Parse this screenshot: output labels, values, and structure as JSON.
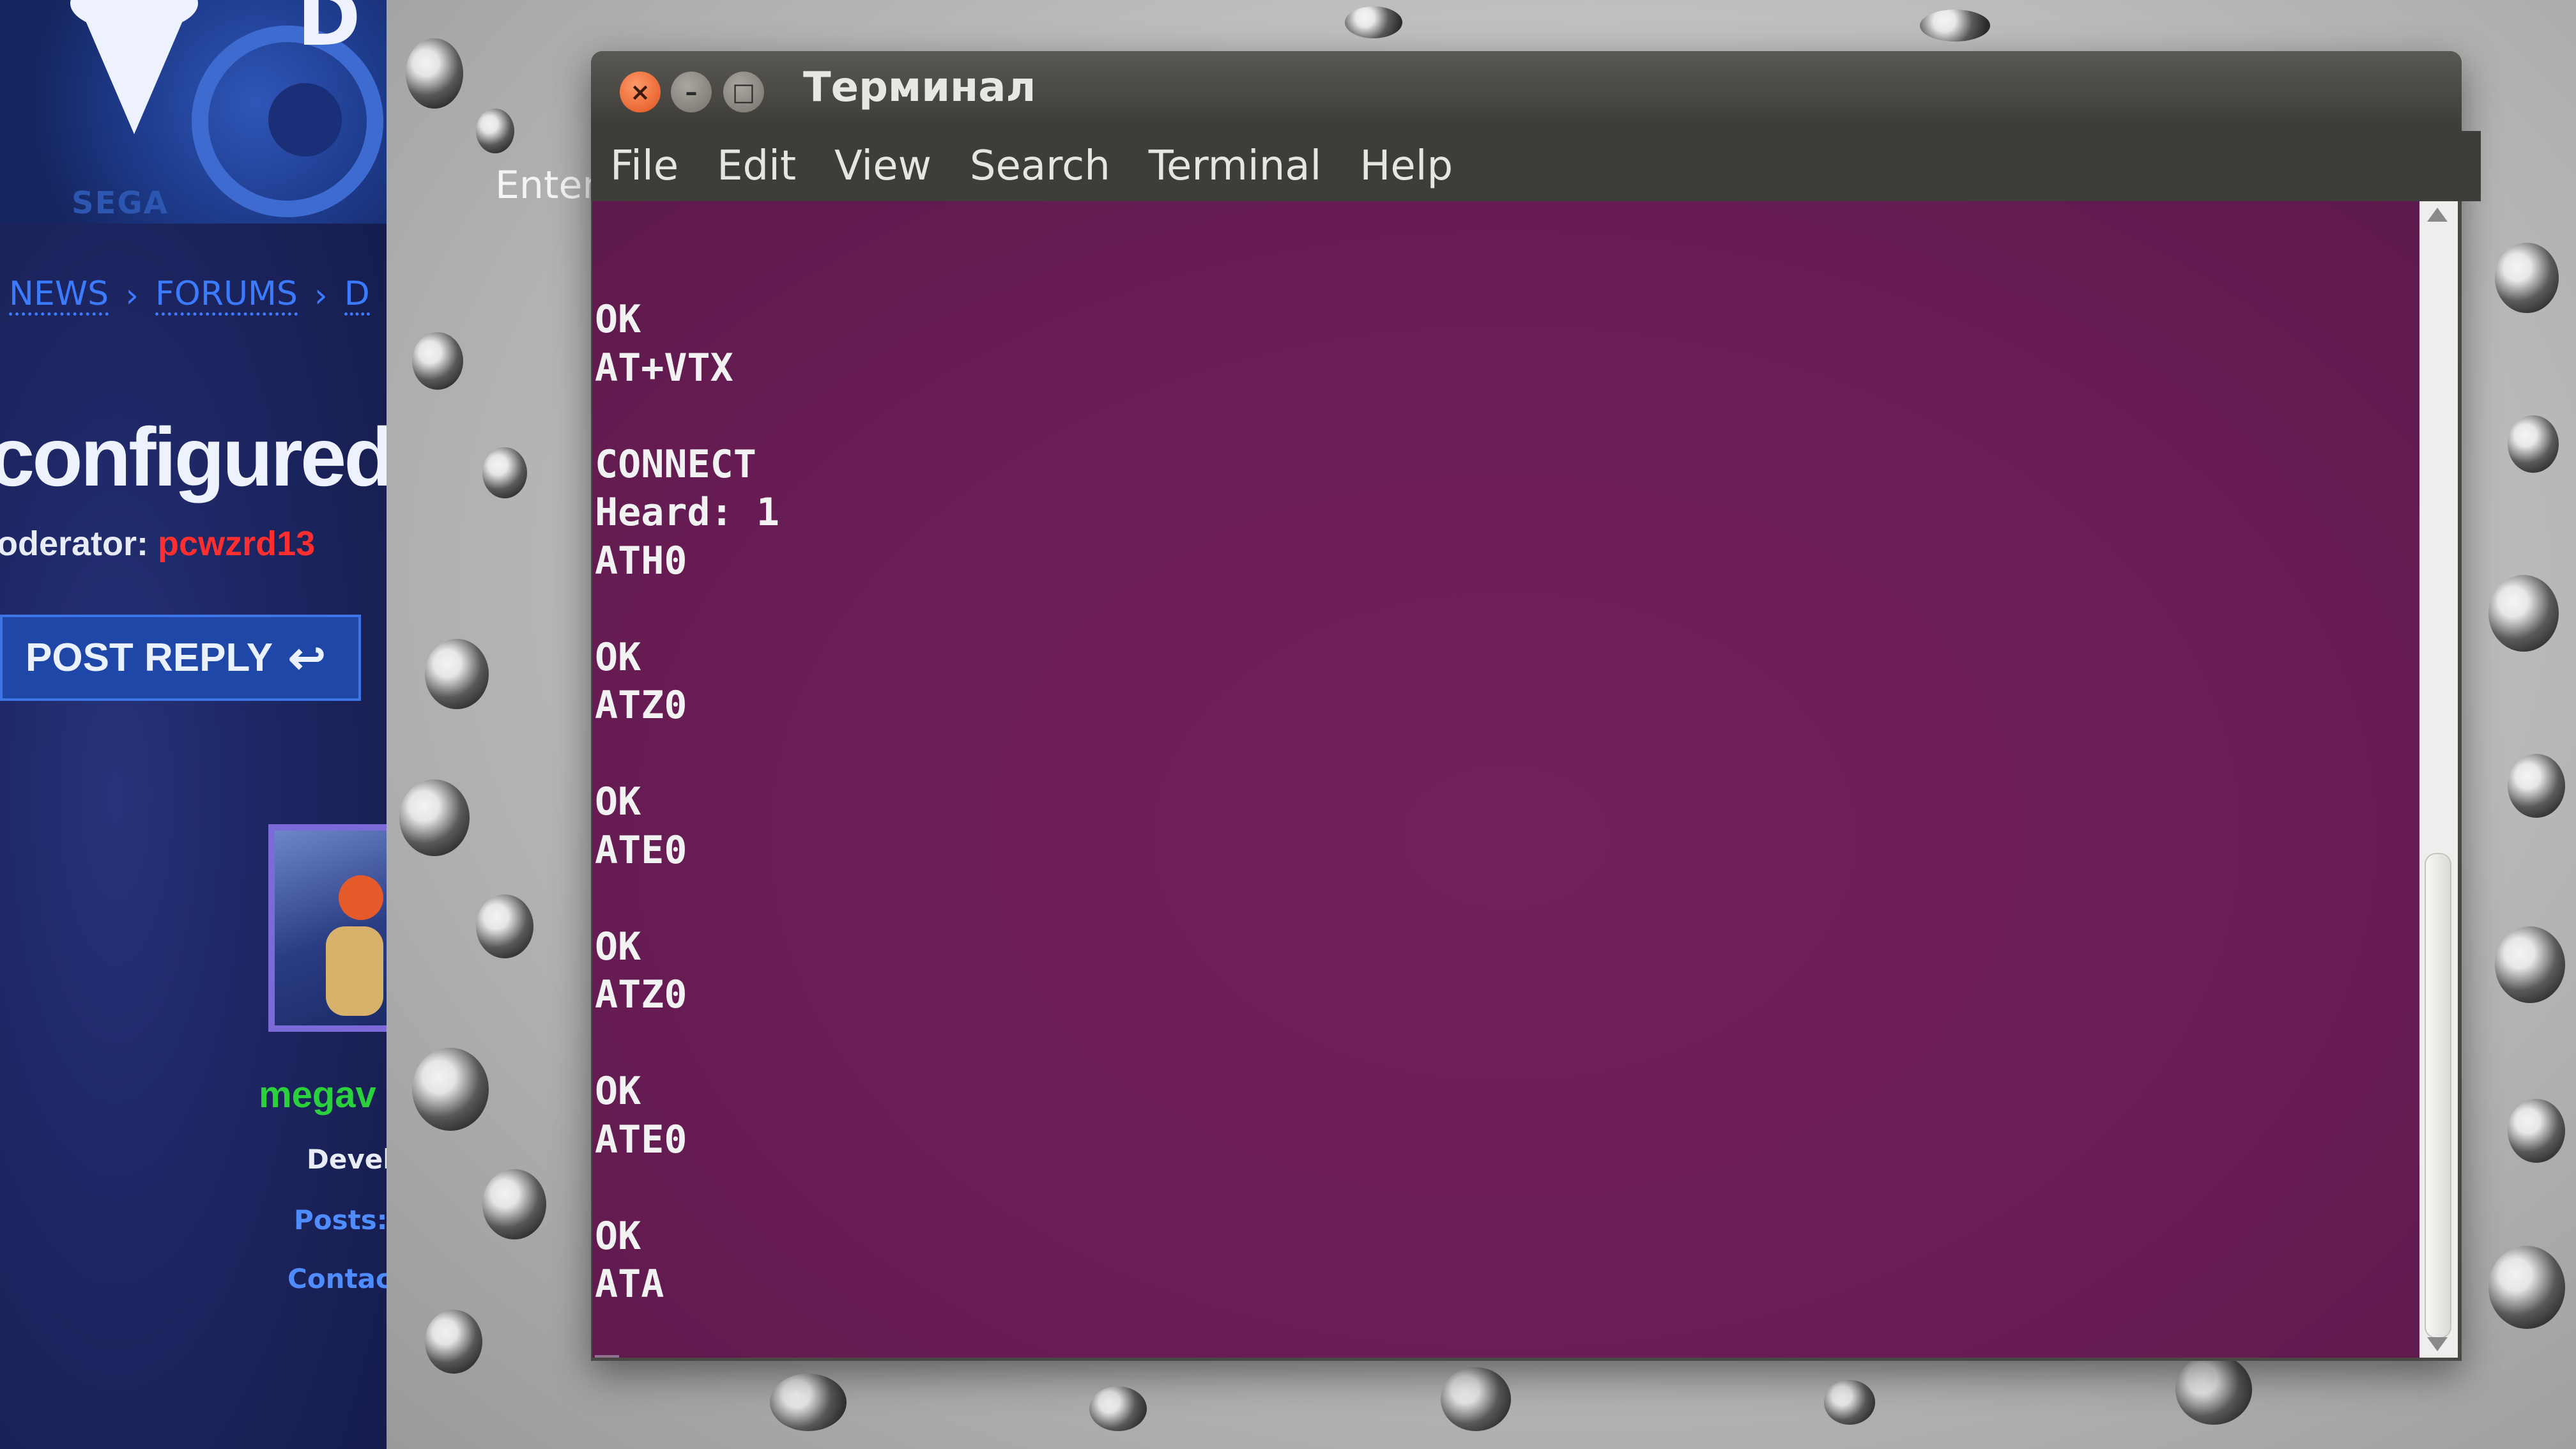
{
  "forum": {
    "logo_text": "SEGA",
    "breadcrumb": [
      "NEWS",
      "FORUMS",
      "D"
    ],
    "title": "configured F",
    "moderator_label": "loderator:",
    "moderator_name": "pcwzrd13",
    "post_reply_label": "POST REPLY",
    "user": {
      "name": "megav",
      "role": "Devel",
      "posts_label": "Posts:",
      "contact_label": "Contact"
    }
  },
  "desktop": {
    "partial_text": "Enter"
  },
  "terminal": {
    "title": "Терминал",
    "menu": [
      "File",
      "Edit",
      "View",
      "Search",
      "Terminal",
      "Help"
    ],
    "lines": [
      "OK",
      "AT+VTX",
      "",
      "CONNECT",
      "Heard: 1",
      "ATH0",
      "",
      "OK",
      "ATZ0",
      "",
      "OK",
      "ATE0",
      "",
      "OK",
      "ATZ0",
      "",
      "OK",
      "ATE0",
      "",
      "OK",
      "ATA"
    ],
    "background_color": "#6a1d56",
    "text_color": "#f2f2f2"
  }
}
